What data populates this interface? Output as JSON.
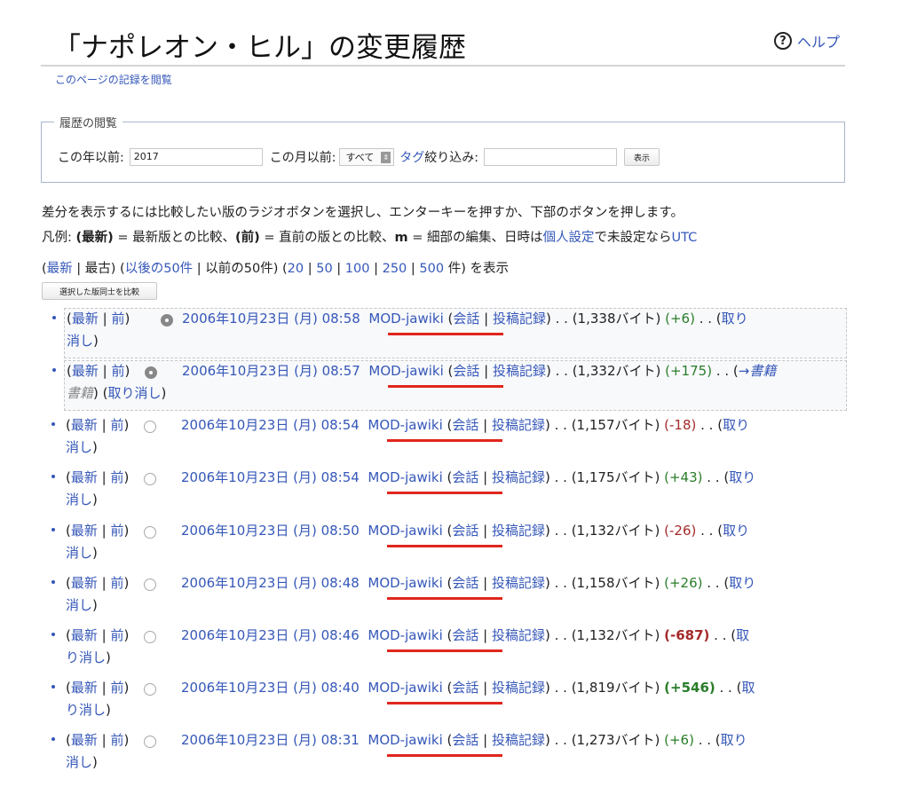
{
  "header": {
    "title": "「ナポレオン・ヒル」の変更履歴",
    "help_label": "ヘルプ",
    "logs_link": "このページの記録を閲覧"
  },
  "browse": {
    "legend": "履歴の閲覧",
    "year_label": "この年以前:",
    "year_value": "2017",
    "month_label": "この月以前:",
    "month_value": "すべて",
    "tag_link": "タグ",
    "tag_label": "絞り込み:",
    "tag_value": "",
    "show_button": "表示"
  },
  "instructions": {
    "line1": "差分を表示するには比較したい版のラジオボタンを選択し、エンターキーを押すか、下部のボタンを押します。",
    "legend_prefix": "凡例: ",
    "legend_cur": "(最新)",
    "legend_mid1": " = 最新版との比較、",
    "legend_prev": "(前)",
    "legend_mid2": " = 直前の版との比較、",
    "legend_m": "m",
    "legend_mid3": " = 細部の編集、日時は",
    "legend_prefs": "個人設定",
    "legend_mid4": "で未設定なら",
    "legend_utc": "UTC"
  },
  "nav": {
    "newest": "最新",
    "sep": " | ",
    "oldest": "最古",
    "newer50": "以後の50件",
    "older50": "以前の50件",
    "limits": [
      "20",
      "50",
      "100",
      "250",
      "500"
    ],
    "unit": "件",
    "suffix": " を表示"
  },
  "compare_button": "選択した版同士を比較",
  "common": {
    "cur": "最新",
    "prev": "前",
    "talk": "会話",
    "contribs": "投稿記録",
    "undo_part1": "取り",
    "undo_part2": "消し",
    "undo_full": "取り消し",
    "restore": "→書籍"
  },
  "revisions": [
    {
      "date": "2006年10月23日 (月) 08:58",
      "user": "MOD-jawiki",
      "size": "(1,338バイト)",
      "diff": "(+6)",
      "sign": "pos"
    },
    {
      "date": "2006年10月23日 (月) 08:57",
      "user": "MOD-jawiki",
      "size": "(1,332バイト)",
      "diff": "(+175)",
      "sign": "pos"
    },
    {
      "date": "2006年10月23日 (月) 08:54",
      "user": "MOD-jawiki",
      "size": "(1,157バイト)",
      "diff": "(-18)",
      "sign": "neg"
    },
    {
      "date": "2006年10月23日 (月) 08:54",
      "user": "MOD-jawiki",
      "size": "(1,175バイト)",
      "diff": "(+43)",
      "sign": "pos"
    },
    {
      "date": "2006年10月23日 (月) 08:50",
      "user": "MOD-jawiki",
      "size": "(1,132バイト)",
      "diff": "(-26)",
      "sign": "neg"
    },
    {
      "date": "2006年10月23日 (月) 08:48",
      "user": "MOD-jawiki",
      "size": "(1,158バイト)",
      "diff": "(+26)",
      "sign": "pos"
    },
    {
      "date": "2006年10月23日 (月) 08:46",
      "user": "MOD-jawiki",
      "size": "(1,132バイト)",
      "diff": "(-687)",
      "sign": "neg"
    },
    {
      "date": "2006年10月23日 (月) 08:40",
      "user": "MOD-jawiki",
      "size": "(1,819バイト)",
      "diff": "(+546)",
      "sign": "pos"
    },
    {
      "date": "2006年10月23日 (月) 08:31",
      "user": "MOD-jawiki",
      "size": "(1,273バイト)",
      "diff": "(+6)",
      "sign": "pos"
    }
  ]
}
